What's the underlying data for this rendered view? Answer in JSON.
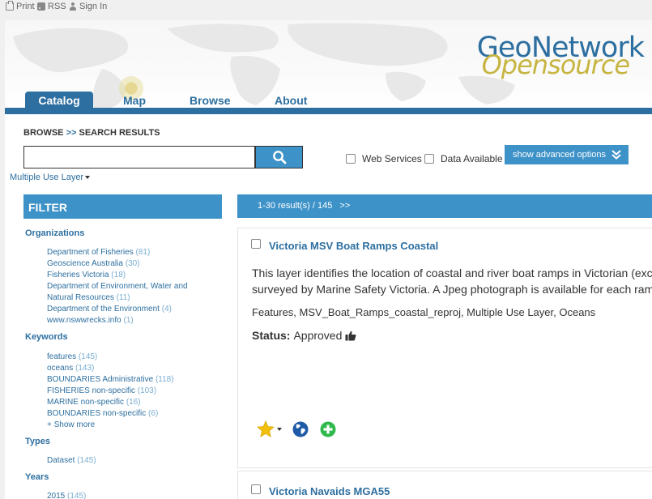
{
  "topbar": {
    "print": "Print",
    "rss": "RSS",
    "signin": "Sign In"
  },
  "logo": {
    "line1": "GeoNetwork",
    "line2": "Opensource"
  },
  "nav": {
    "tabs": [
      "Catalog",
      "Map",
      "Browse",
      "About"
    ],
    "active": "Catalog"
  },
  "breadcrumb": {
    "browse": "BROWSE",
    "sep": ">>",
    "current": "SEARCH RESULTS"
  },
  "search": {
    "value": "",
    "placeholder": ""
  },
  "options": {
    "web_services": "Web Services",
    "data_available": "Data Available",
    "advanced": "show advanced options"
  },
  "multiple_use": "Multiple Use Layer",
  "filter": {
    "title": "FILTER",
    "organizations": {
      "title": "Organizations",
      "items": [
        {
          "name": "Department of Fisheries",
          "count": "(81)"
        },
        {
          "name": "Geoscience Australia",
          "count": "(30)"
        },
        {
          "name": "Fisheries Victoria",
          "count": "(18)"
        },
        {
          "name": "Department of Environment, Water and Natural Resources",
          "count": "(11)"
        },
        {
          "name": "Department of the Environment",
          "count": "(4)"
        },
        {
          "name": "www.nswwrecks.info",
          "count": "(1)"
        }
      ]
    },
    "keywords": {
      "title": "Keywords",
      "items": [
        {
          "name": "features",
          "count": "(145)"
        },
        {
          "name": "oceans",
          "count": "(143)"
        },
        {
          "name": "BOUNDARIES Administrative",
          "count": "(118)"
        },
        {
          "name": "FISHERIES non-specific",
          "count": "(103)"
        },
        {
          "name": "MARINE non-specific",
          "count": "(16)"
        },
        {
          "name": "BOUNDARIES non-specific",
          "count": "(6)"
        }
      ],
      "more": "+ Show more"
    },
    "types": {
      "title": "Types",
      "items": [
        {
          "name": "Dataset",
          "count": "(145)"
        }
      ]
    },
    "years": {
      "title": "Years",
      "items": [
        {
          "name": "2015",
          "count": "(145)"
        }
      ]
    }
  },
  "results": {
    "summary": "1-30 result(s) / 145",
    "next": ">>",
    "items": [
      {
        "title": "Victoria MSV Boat Ramps Coastal",
        "description_line1": "This layer identifies the location of coastal and river boat ramps in Victorian (exc",
        "description_line2": "surveyed by Marine Safety Victoria. A Jpeg photograph is available for each ram",
        "keywords": "Features, MSV_Boat_Ramps_coastal_reproj, Multiple Use Layer, Oceans",
        "status_label": "Status:",
        "status_value": "Approved"
      },
      {
        "title": "Victoria Navaids MGA55"
      }
    ]
  },
  "colors": {
    "brand": "#2d6fa0",
    "accent": "#3d92c8",
    "logo_gold": "#c7b541",
    "add": "#2fb84c"
  },
  "icons": [
    "print-icon",
    "rss-icon",
    "user-icon",
    "search-icon",
    "chevrons-down-icon",
    "star-icon",
    "globe-icon",
    "plus-icon",
    "thumbs-up-icon"
  ]
}
